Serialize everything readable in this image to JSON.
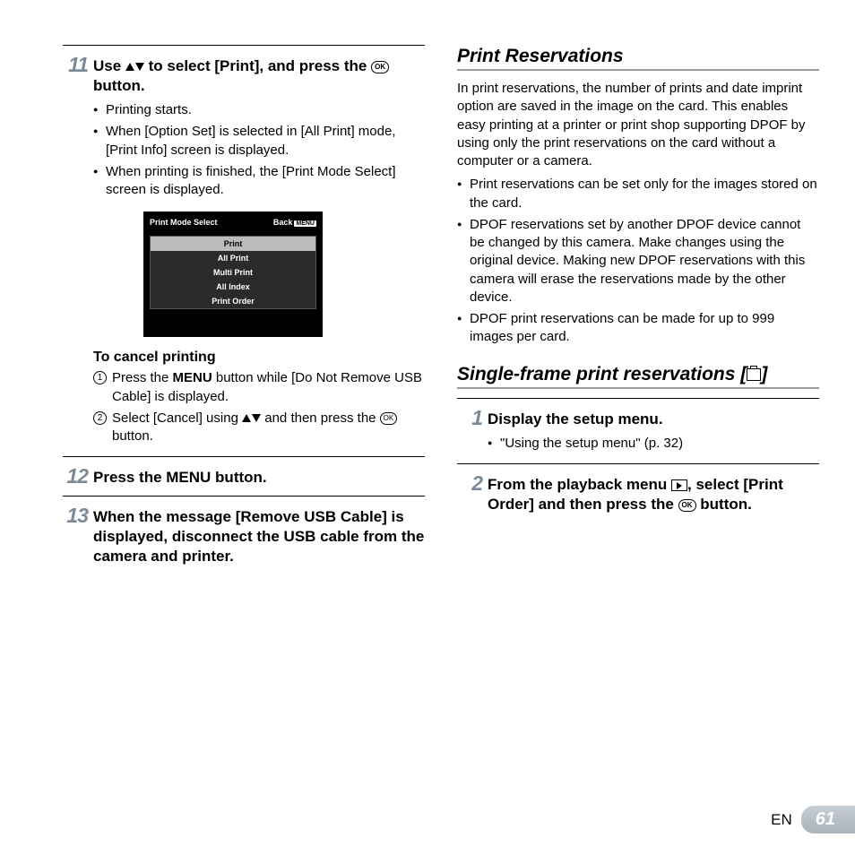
{
  "left": {
    "step11": {
      "num": "11",
      "title_pre": "Use ",
      "title_mid": " to select [Print], and press the ",
      "title_post": " button.",
      "bullets": [
        "Printing starts.",
        "When [Option Set] is selected in [All Print] mode, [Print Info] screen is displayed.",
        "When printing is finished, the [Print Mode Select] screen is displayed."
      ]
    },
    "screen": {
      "title": "Print Mode Select",
      "back": "Back",
      "menu_badge": "MENU",
      "items": [
        "Print",
        "All Print",
        "Multi Print",
        "All Index",
        "Print Order"
      ]
    },
    "cancel": {
      "heading": "To cancel printing",
      "item1_pre": "Press the ",
      "item1_bold": "MENU",
      "item1_post": " button while [Do Not Remove USB Cable] is displayed.",
      "item2_pre": "Select [Cancel] using ",
      "item2_mid": " and then press the ",
      "item2_post": " button."
    },
    "step12": {
      "num": "12",
      "pre": "Press the ",
      "bold": "MENU",
      "post": " button."
    },
    "step13": {
      "num": "13",
      "text": "When the message [Remove USB Cable] is displayed, disconnect the USB cable from the camera and printer."
    }
  },
  "right": {
    "sec1_title": "Print Reservations",
    "sec1_para": "In print reservations, the number of prints and date imprint option are saved in the image on the card. This enables easy printing at a printer or print shop supporting DPOF by using only the print reservations on the card without a computer or a camera.",
    "sec1_bullets": [
      "Print reservations can be set only for the images stored on the card.",
      "DPOF reservations set by another DPOF device cannot be changed by this camera. Make changes using the original device. Making new DPOF reservations with this camera will erase the reservations made by the other device.",
      "DPOF print reservations can be made for up to 999 images per card."
    ],
    "sec2_title_pre": "Single-frame print reservations [",
    "sec2_title_post": "]",
    "step1": {
      "num": "1",
      "title": "Display the setup menu.",
      "bullet": "\"Using the setup menu\" (p. 32)"
    },
    "step2": {
      "num": "2",
      "pre": "From the playback menu ",
      "mid": ", select [Print Order] and then press the ",
      "post": " button."
    }
  },
  "footer": {
    "lang": "EN",
    "page": "61"
  }
}
